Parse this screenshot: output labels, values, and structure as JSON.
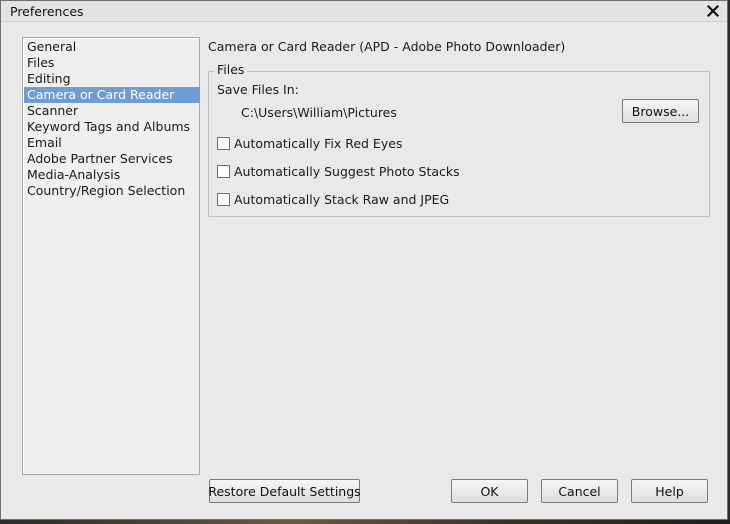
{
  "window": {
    "title": "Preferences"
  },
  "sidebar": {
    "items": [
      {
        "label": "General",
        "selected": false
      },
      {
        "label": "Files",
        "selected": false
      },
      {
        "label": "Editing",
        "selected": false
      },
      {
        "label": "Camera or Card Reader",
        "selected": true
      },
      {
        "label": "Scanner",
        "selected": false
      },
      {
        "label": "Keyword Tags and Albums",
        "selected": false
      },
      {
        "label": "Email",
        "selected": false
      },
      {
        "label": "Adobe Partner Services",
        "selected": false
      },
      {
        "label": "Media-Analysis",
        "selected": false
      },
      {
        "label": "Country/Region Selection",
        "selected": false
      }
    ]
  },
  "main": {
    "heading": "Camera or Card Reader (APD - Adobe Photo Downloader)",
    "files_group": {
      "legend": "Files",
      "save_label": "Save Files In:",
      "save_path": "C:\\Users\\William\\Pictures",
      "browse_label": "Browse...",
      "options": [
        {
          "label": "Automatically Fix Red Eyes",
          "checked": false
        },
        {
          "label": "Automatically Suggest Photo Stacks",
          "checked": false
        },
        {
          "label": "Automatically Stack Raw and JPEG",
          "checked": false
        }
      ]
    }
  },
  "footer": {
    "restore_label": "Restore Default Settings",
    "ok_label": "OK",
    "cancel_label": "Cancel",
    "help_label": "Help"
  },
  "colors": {
    "selection": "#6f9cd4",
    "window_bg": "#e9e9e9"
  },
  "icons": {
    "close": "close-icon"
  }
}
